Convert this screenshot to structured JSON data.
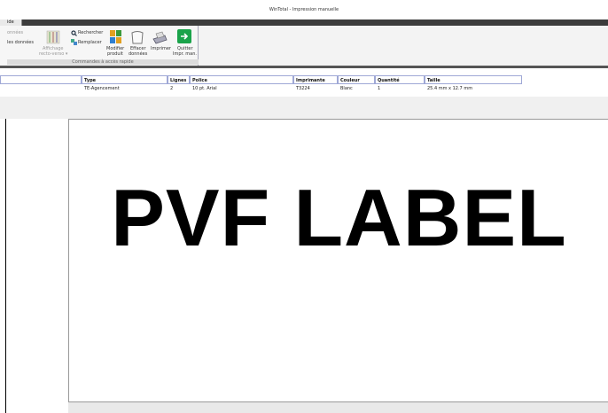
{
  "window": {
    "title": "WinTotal - Impression manuelle"
  },
  "menu": {
    "active_tab": "ide"
  },
  "ribbon": {
    "truncated_top": "onnées",
    "les_donnees": "les données",
    "affichage_line1": "Affichage",
    "affichage_line2": "recto-verso ▾",
    "rechercher": "Rechercher",
    "remplacer": "Remplacer",
    "modifier_line1": "Modifier",
    "modifier_line2": "produit",
    "effacer_line1": "Effacer",
    "effacer_line2": "données",
    "imprimer": "Imprimer",
    "quitter_line1": "Quitter",
    "quitter_line2": "Impr. man.",
    "group_caption": "Commandes à accès rapide"
  },
  "table": {
    "headers": {
      "type": "Type",
      "lignes": "Lignes",
      "police": "Police",
      "imprimante": "Imprimante",
      "couleur": "Couleur",
      "quantite": "Quantité",
      "taille": "Taille"
    },
    "row": {
      "type": "TE-Agencement",
      "lignes": "2",
      "police": "10 pt. Arial",
      "imprimante": "T3224",
      "couleur": "Blanc",
      "quantite": "1",
      "taille": "25.4 mm x 12.7 mm"
    }
  },
  "label_preview": {
    "text": "PVF LABEL"
  },
  "colors": {
    "quit_icon": "#1aa34a",
    "header_border": "#9fa8d6",
    "menubar": "#3c3c3c"
  }
}
